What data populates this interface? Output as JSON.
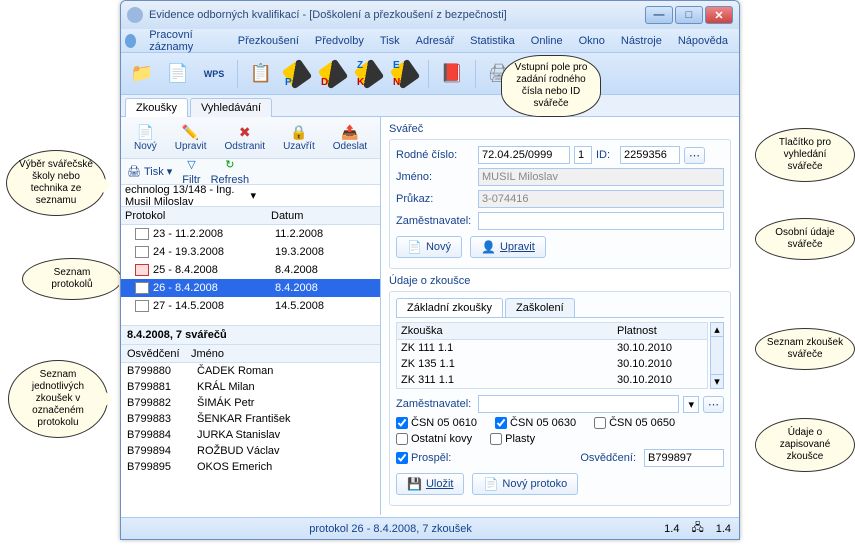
{
  "window": {
    "title": "Evidence odborných kvalifikací - [Doškolení a přezkoušení z bezpečnosti]"
  },
  "menu": [
    "Pracovní záznamy",
    "Přezkoušení",
    "Předvolby",
    "Tisk",
    "Adresář",
    "Statistika",
    "Online",
    "Okno",
    "Nástroje",
    "Nápověda"
  ],
  "main_tabs": {
    "t1": "Zkoušky",
    "t2": "Vyhledávání"
  },
  "left_toolbar": {
    "new": "Nový",
    "edit": "Upravit",
    "delete": "Odstranit",
    "close": "Uzavřít",
    "send": "Odeslat"
  },
  "left_toolbar2": {
    "print": "Tisk",
    "filter": "Filtr",
    "refresh": "Refresh"
  },
  "school_line": "echnolog 13/148 - Ing. Musil Miloslav",
  "proto": {
    "h1": "Protokol",
    "h2": "Datum",
    "rows": [
      {
        "n": "23 - 11.2.2008",
        "d": "11.2.2008"
      },
      {
        "n": "24 - 19.3.2008",
        "d": "19.3.2008"
      },
      {
        "n": "25 - 8.4.2008",
        "d": "8.4.2008"
      },
      {
        "n": "26 - 8.4.2008",
        "d": "8.4.2008"
      },
      {
        "n": "27 - 14.5.2008",
        "d": "14.5.2008"
      }
    ]
  },
  "sub_title": "8.4.2008, 7 svářečů",
  "welders": {
    "h1": "Osvědčení",
    "h2": "Jméno",
    "rows": [
      {
        "c": "B799880",
        "n": "ČADEK Roman"
      },
      {
        "c": "B799881",
        "n": "KRÁL Milan"
      },
      {
        "c": "B799882",
        "n": "ŠIMÁK Petr"
      },
      {
        "c": "B799883",
        "n": "ŠENKAR František"
      },
      {
        "c": "B799884",
        "n": "JURKA Stanislav"
      },
      {
        "c": "B799894",
        "n": "ROŽBUD Václav"
      },
      {
        "c": "B799895",
        "n": "OKOS Emerich"
      }
    ]
  },
  "welder_box": {
    "title": "Svářeč",
    "rc_label": "Rodné číslo:",
    "rc": "72.04.25/0999",
    "seq": "1",
    "id_label": "ID:",
    "id": "2259356",
    "name_label": "Jméno:",
    "name": "MUSIL Miloslav",
    "card_label": "Průkaz:",
    "card": "3-074416",
    "emp_label": "Zaměstnavatel:",
    "emp": "",
    "new": "Nový",
    "edit": "Upravit"
  },
  "exam_box": {
    "title": "Údaje o zkoušce",
    "tab1": "Základní zkoušky",
    "tab2": "Zaškolení",
    "h1": "Zkouška",
    "h2": "Platnost",
    "rows": [
      {
        "z": "ZK 111 1.1",
        "p": "30.10.2010"
      },
      {
        "z": "ZK 135 1.1",
        "p": "30.10.2010"
      },
      {
        "z": "ZK 311 1.1",
        "p": "30.10.2010"
      }
    ],
    "emp_label": "Zaměstnavatel:",
    "csn1": "ČSN 05 0610",
    "csn2": "ČSN 05 0630",
    "csn3": "ČSN 05 0650",
    "kovy": "Ostatní kovy",
    "plasty": "Plasty",
    "pass": "Prospěl:",
    "cert_label": "Osvědčení:",
    "cert": "B799897",
    "save": "Uložit",
    "newp": "Nový protoko"
  },
  "status": {
    "main": "protokol 26 - 8.4.2008, 7 zkoušek",
    "v1": "1.4",
    "v2": "1.4"
  },
  "callouts": {
    "c1": "Výběr svářečské školy nebo technika ze seznamu",
    "c2": "Seznam protokolů",
    "c3": "Seznam jednotlivých zkoušek v označeném protokolu",
    "c4": "Vstupní pole pro zadání rodného čísla nebo ID svářeče",
    "c5": "Tlačítko pro vyhledání svářeče",
    "c6": "Osobní údaje svářeče",
    "c7": "Seznam zkoušek svářeče",
    "c8": "Údaje o zapisované zkoušce"
  }
}
